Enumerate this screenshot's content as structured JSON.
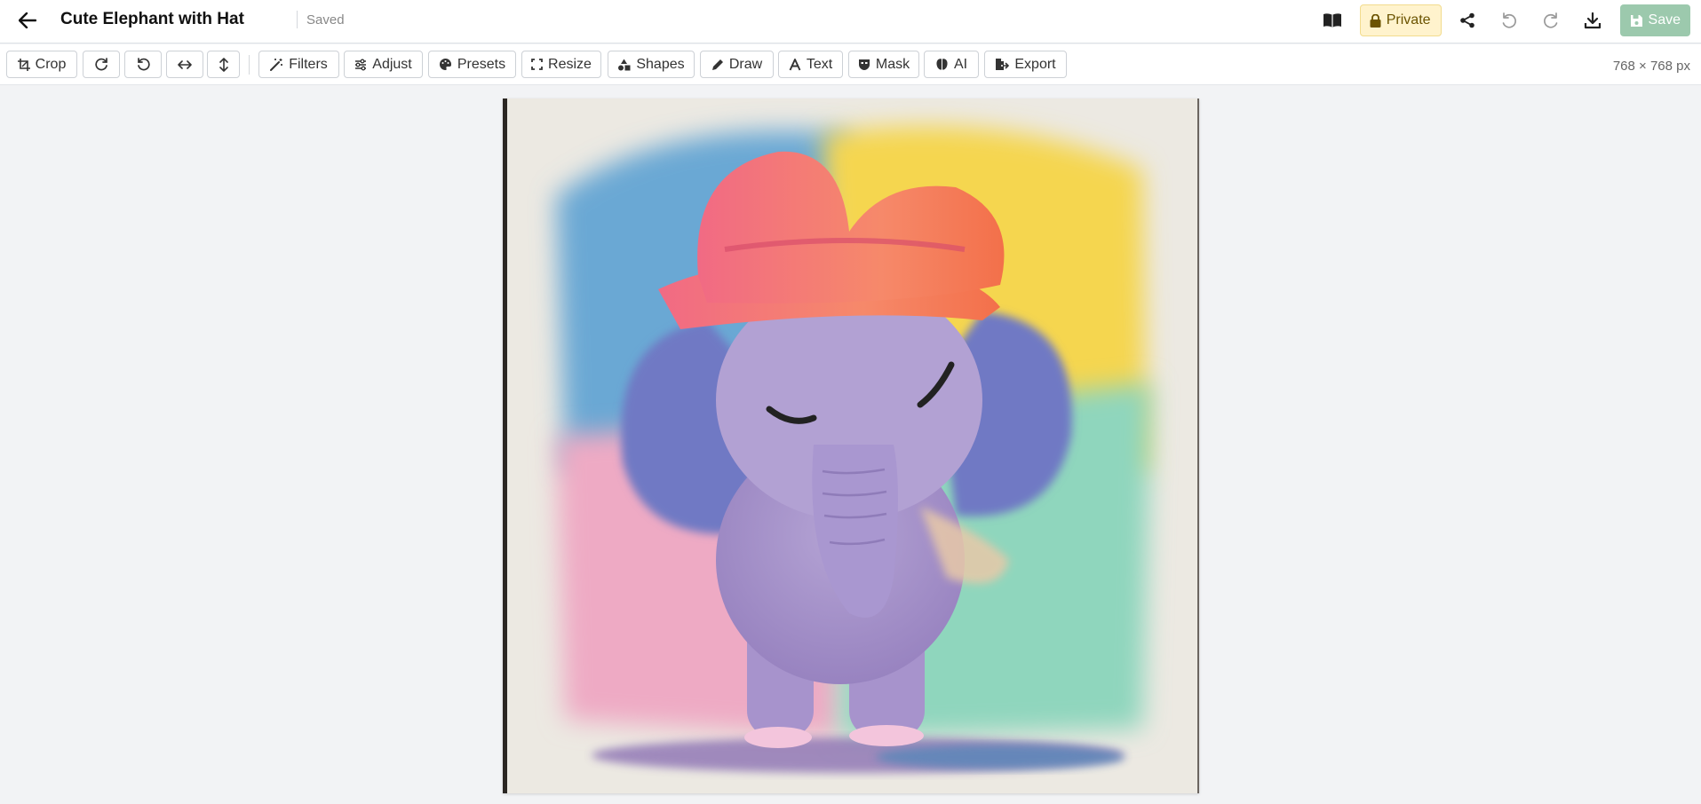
{
  "header": {
    "title": "Cute Elephant with Hat",
    "status": "Saved",
    "private_label": "Private",
    "save_label": "Save"
  },
  "toolbar": {
    "crop_label": "Crop",
    "filters_label": "Filters",
    "adjust_label": "Adjust",
    "presets_label": "Presets",
    "resize_label": "Resize",
    "shapes_label": "Shapes",
    "draw_label": "Draw",
    "text_label": "Text",
    "mask_label": "Mask",
    "ai_label": "AI",
    "export_label": "Export",
    "dimensions": "768 × 768 px"
  },
  "icons": {
    "back": "arrow-left-icon",
    "book": "book-icon",
    "lock": "lock-icon",
    "share": "share-icon",
    "undo": "undo-icon",
    "redo": "redo-icon",
    "download": "download-icon",
    "save": "floppy-icon"
  },
  "colors": {
    "save_button": "#9cc9ad",
    "private_badge_bg": "#fff3cd",
    "private_badge_text": "#6b5300",
    "canvas_bg": "#f2f3f5"
  }
}
